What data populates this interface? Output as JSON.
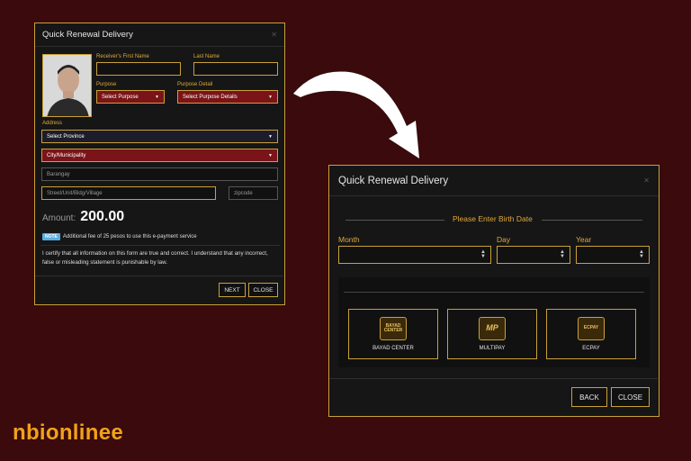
{
  "modal1": {
    "title": "Quick Renewal Delivery",
    "first_name_label": "Receiver's First Name",
    "last_name_label": "Last Name",
    "purpose_label": "Purpose",
    "purpose_value": "Select Purpose",
    "purpose_detail_label": "Purpose Detail",
    "purpose_detail_value": "Select Purpose Details",
    "address_label": "Address",
    "province_value": "Select Province",
    "city_value": "City/Municipality",
    "barangay_placeholder": "Barangay",
    "street_placeholder": "Street/Unit/Bldg/Village",
    "zipcode_placeholder": "zipcode",
    "amount_label": "Amount:",
    "amount_value": "200.00",
    "note_badge": "NOTE",
    "note_text": "Additional fee of 25 pesos to use this e-payment service",
    "certify_text": "I certify that all information on this form are true and correct. I understand that any incorrect, false or misleading statement is punishable by law.",
    "next_label": "NEXT",
    "close_label": "CLOSE"
  },
  "modal2": {
    "title": "Quick Renewal Delivery",
    "birth_date_title": "Please Enter Birth Date",
    "month_label": "Month",
    "day_label": "Day",
    "year_label": "Year",
    "payment_options": [
      {
        "label": "BAYAD CENTER",
        "logo_text": "BAYAD CENTER"
      },
      {
        "label": "MULTIPAY",
        "logo_text": "MP"
      },
      {
        "label": "ECPAY",
        "logo_text": "ECPAY"
      }
    ],
    "back_label": "BACK",
    "close_label": "CLOSE"
  },
  "brand": "nbionlinee",
  "colors": {
    "background": "#3a0a0c",
    "accent": "#c9a13a",
    "label": "#e0a93a",
    "select": "#7a1418",
    "brand": "#f0a21a",
    "note": "#5aaee0"
  }
}
